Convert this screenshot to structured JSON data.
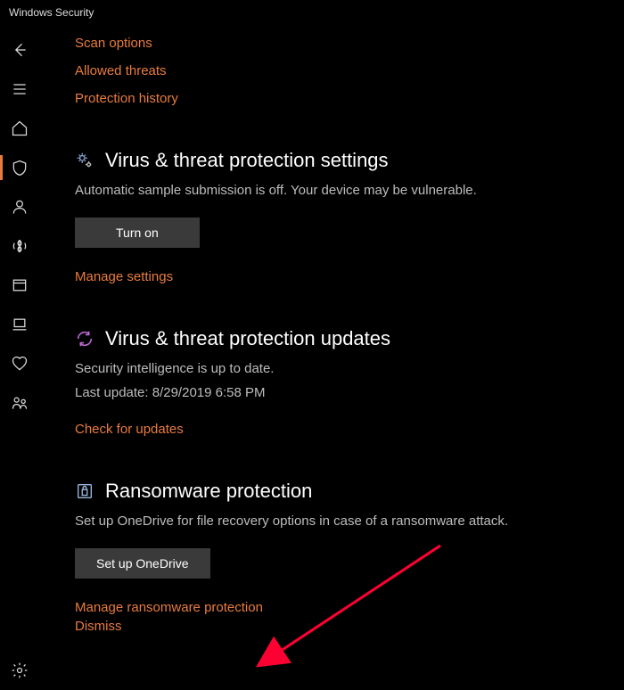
{
  "window": {
    "title": "Windows Security"
  },
  "top_links": {
    "scan_options": "Scan options",
    "allowed_threats": "Allowed threats",
    "protection_history": "Protection history"
  },
  "settings_section": {
    "title": "Virus & threat protection settings",
    "description": "Automatic sample submission is off. Your device may be vulnerable.",
    "turn_on_label": "Turn on",
    "manage_link": "Manage settings"
  },
  "updates_section": {
    "title": "Virus & threat protection updates",
    "status": "Security intelligence is up to date.",
    "last_update": "Last update: 8/29/2019 6:58 PM",
    "check_link": "Check for updates"
  },
  "ransomware_section": {
    "title": "Ransomware protection",
    "description": "Set up OneDrive for file recovery options in case of a ransomware attack.",
    "setup_label": "Set up OneDrive",
    "manage_link": "Manage ransomware protection",
    "dismiss_link": "Dismiss"
  }
}
